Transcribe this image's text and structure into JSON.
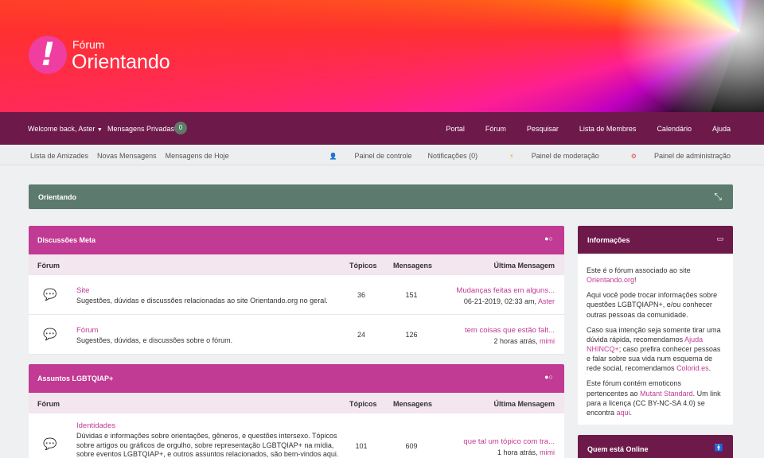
{
  "header": {
    "logo_small": "Fórum",
    "logo_big": "Orientando"
  },
  "navbar": {
    "welcome": "Welcome back, Aster",
    "private_messages": "Mensagens Privadas",
    "pm_count": "0",
    "links": [
      "Portal",
      "Fórum",
      "Pesquisar",
      "Lista de Membres",
      "Calendário",
      "Ajuda"
    ]
  },
  "subnav": {
    "left": [
      "Lista de Amizades",
      "Novas Mensagens",
      "Mensagens de Hoje"
    ],
    "control_panel": "Painel de controle",
    "notifications": "Notificações (0)",
    "mod_panel": "Painel de moderação",
    "admin_panel": "Painel de administração"
  },
  "breadcrumb": {
    "label": "Orientando"
  },
  "col_headers": {
    "forum": "Fórum",
    "topics": "Tópicos",
    "messages": "Mensagens",
    "last": "Última Mensagem"
  },
  "categories": [
    {
      "title": "Discussões Meta",
      "rows": [
        {
          "name": "Site",
          "desc": "Sugestões, dúvidas e discussões relacionadas ao site Orientando.org no geral.",
          "topics": "36",
          "messages": "151",
          "last_title": "Mudanças feitas em alguns...",
          "last_date": "06-21-2019, 02:33 am, ",
          "last_user": "Aster"
        },
        {
          "name": "Fórum",
          "desc": "Sugestões, dúvidas, e discussões sobre o fórum.",
          "topics": "24",
          "messages": "126",
          "last_title": "tem coisas que estão falt...",
          "last_date": "2 horas atrás, ",
          "last_user": "mimi"
        }
      ]
    },
    {
      "title": "Assuntos LGBTQIAP+",
      "rows": [
        {
          "name": "Identidades",
          "desc": "Dúvidas e informações sobre orientações, gêneros, e questões intersexo. Tópicos sobre artigos ou gráficos de orgulho, sobre representação LGBTQIAP+ na mídia, sobre eventos LGBTQIAP+, e outros assuntos relacionados, são bem-vindos aqui.",
          "topics": "101",
          "messages": "609",
          "last_title": "que tal um tópico com tra...",
          "last_date": "1 hora atrás, ",
          "last_user": "mimi"
        }
      ]
    }
  ],
  "sidebar": {
    "info_title": "Informações",
    "info_p1_a": "Este é o fórum associado ao site ",
    "info_p1_link": "Orientando.org",
    "info_p1_b": "!",
    "info_p2": "Aqui você pode trocar informações sobre questões LGBTQIAPN+, e/ou conhecer outras pessoas da comunidade.",
    "info_p3_a": "Caso sua intenção seja somente tirar uma dúvida rápida, recomendamos ",
    "info_p3_link1": "Ajuda NHINCQ+",
    "info_p3_b": "; caso prefira conhecer pessoas e falar sobre sua vida num esquema de rede social, recomendamos ",
    "info_p3_link2": "Colorid.es",
    "info_p3_c": ".",
    "info_p4_a": "Este fórum contém emoticons pertencentes ao ",
    "info_p4_link1": "Mutant Standard",
    "info_p4_b": ". Um link para a licença (CC BY-NC-SA 4.0) se encontra ",
    "info_p4_link2": "aqui",
    "info_p4_c": ".",
    "online_title": "Quem está Online"
  }
}
